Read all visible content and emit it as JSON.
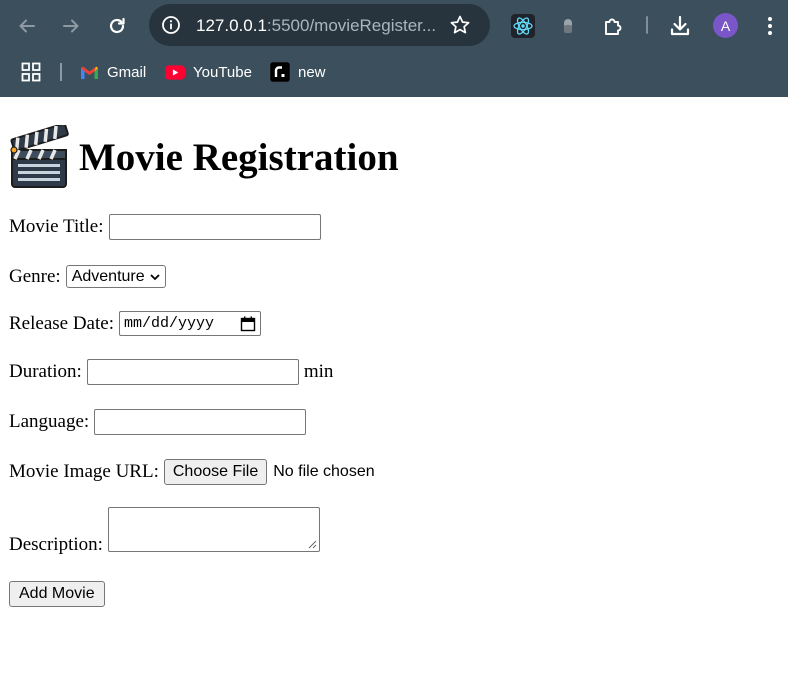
{
  "browser": {
    "url_host": "127.0.0.1",
    "url_rest": ":5500/movieRegister...",
    "avatar_letter": "A",
    "bookmarks": [
      {
        "label": "Gmail",
        "icon": "gmail-icon"
      },
      {
        "label": "YouTube",
        "icon": "youtube-icon"
      },
      {
        "label": "new",
        "icon": "new-site-icon"
      }
    ],
    "colors": {
      "frame": "#3c4f5c",
      "omnibox": "#27343d",
      "avatar": "#7a56c8"
    }
  },
  "page": {
    "title": "Movie Registration",
    "title_icon": "clapperboard-icon",
    "fields": {
      "title_label": "Movie Title:",
      "genre_label": "Genre:",
      "genre_value": "Adventure",
      "release_label": "Release Date:",
      "release_placeholder": "mm/dd/yyyy",
      "duration_label": "Duration:",
      "duration_unit": "min",
      "language_label": "Language:",
      "image_label": "Movie Image URL:",
      "file_button": "Choose File",
      "file_status": "No file chosen",
      "description_label": "Description:"
    },
    "submit_label": "Add Movie"
  }
}
